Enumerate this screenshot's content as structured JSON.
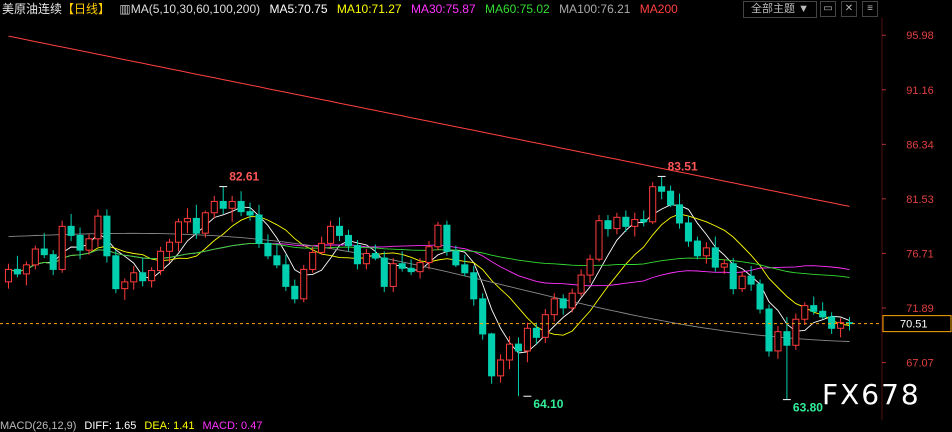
{
  "header": {
    "title": "美原油连续",
    "period": "【日线】",
    "ma_params": "MA(5,10,30,60,100,200)",
    "ma5": "MA5:70.75",
    "ma10": "MA10:71.27",
    "ma30": "MA30:75.87",
    "ma60": "MA60:75.02",
    "ma100": "MA100:76.21",
    "ma200": "MA200",
    "theme_button": "全部主题 ▼",
    "colors": {
      "ma5": "#ffffff",
      "ma10": "#ffff00",
      "ma30": "#ff33ff",
      "ma60": "#33dd33",
      "ma100": "#aaaaaa",
      "ma200": "#ff4040"
    }
  },
  "macd_line": {
    "label": "MACD(26,12,9)",
    "diff": "DIFF: 1.65",
    "dea": "DEA: 1.41",
    "macd": "MACD: 0.47"
  },
  "watermark": "FX678",
  "chart_data": {
    "type": "candlestick",
    "ylim": [
      62.0,
      97.5
    ],
    "yticks": [
      "95.98",
      "91.16",
      "86.34",
      "81.53",
      "76.71",
      "71.89",
      "67.07"
    ],
    "current_price": "70.51",
    "annotations": [
      {
        "label": "82.61",
        "index": 24,
        "value": 82.61,
        "kind": "high"
      },
      {
        "label": "83.51",
        "index": 73,
        "value": 83.51,
        "kind": "high"
      },
      {
        "label": "64.10",
        "index": 58,
        "value": 64.1,
        "kind": "low"
      },
      {
        "label": "63.80",
        "index": 87,
        "value": 63.8,
        "kind": "low"
      }
    ],
    "candles": [
      [
        74.2,
        75.8,
        73.6,
        75.3
      ],
      [
        75.3,
        76.5,
        74.6,
        74.9
      ],
      [
        74.9,
        76.0,
        73.9,
        75.7
      ],
      [
        75.7,
        77.4,
        75.3,
        77.1
      ],
      [
        77.1,
        78.5,
        76.3,
        76.6
      ],
      [
        76.6,
        77.0,
        74.8,
        75.3
      ],
      [
        75.3,
        79.6,
        75.0,
        79.1
      ],
      [
        79.1,
        80.2,
        77.8,
        78.3
      ],
      [
        78.3,
        79.0,
        76.2,
        77.0
      ],
      [
        77.0,
        78.4,
        76.6,
        78.0
      ],
      [
        78.0,
        80.6,
        77.3,
        80.0
      ],
      [
        80.0,
        80.6,
        75.9,
        76.5
      ],
      [
        76.5,
        77.0,
        73.2,
        73.6
      ],
      [
        73.6,
        74.5,
        72.6,
        74.2
      ],
      [
        74.2,
        75.6,
        73.5,
        75.0
      ],
      [
        75.0,
        76.3,
        73.8,
        74.3
      ],
      [
        74.3,
        75.5,
        73.7,
        75.2
      ],
      [
        75.2,
        77.3,
        74.8,
        76.9
      ],
      [
        76.9,
        78.0,
        75.9,
        77.7
      ],
      [
        77.7,
        79.8,
        76.9,
        79.5
      ],
      [
        79.5,
        80.7,
        78.5,
        79.8
      ],
      [
        79.8,
        81.0,
        78.0,
        78.5
      ],
      [
        78.5,
        80.5,
        78.1,
        80.3
      ],
      [
        80.3,
        81.8,
        79.8,
        81.3
      ],
      [
        81.3,
        82.61,
        80.2,
        80.7
      ],
      [
        80.7,
        81.8,
        79.5,
        81.3
      ],
      [
        81.3,
        82.2,
        80.0,
        80.4
      ],
      [
        80.4,
        81.2,
        79.6,
        80.1
      ],
      [
        80.1,
        81.0,
        77.2,
        77.6
      ],
      [
        77.6,
        78.4,
        76.2,
        76.5
      ],
      [
        76.5,
        77.6,
        75.4,
        75.7
      ],
      [
        75.7,
        76.6,
        73.4,
        73.8
      ],
      [
        73.8,
        74.4,
        72.3,
        72.7
      ],
      [
        72.7,
        75.7,
        72.4,
        75.3
      ],
      [
        75.3,
        77.3,
        75.0,
        76.8
      ],
      [
        76.8,
        78.2,
        76.6,
        77.6
      ],
      [
        77.6,
        79.6,
        77.1,
        79.1
      ],
      [
        79.1,
        79.9,
        77.8,
        78.3
      ],
      [
        78.3,
        78.8,
        76.9,
        77.4
      ],
      [
        77.4,
        77.9,
        75.3,
        75.8
      ],
      [
        75.8,
        77.1,
        75.3,
        76.7
      ],
      [
        76.7,
        77.5,
        76.1,
        76.3
      ],
      [
        76.3,
        76.9,
        73.3,
        73.8
      ],
      [
        73.8,
        76.3,
        73.3,
        75.8
      ],
      [
        75.8,
        76.9,
        75.1,
        75.4
      ],
      [
        75.4,
        76.2,
        74.8,
        75.1
      ],
      [
        75.1,
        76.3,
        74.5,
        75.9
      ],
      [
        75.9,
        77.8,
        75.3,
        77.3
      ],
      [
        77.3,
        79.5,
        77.0,
        79.2
      ],
      [
        79.2,
        79.6,
        76.5,
        76.9
      ],
      [
        76.9,
        77.4,
        75.5,
        75.7
      ],
      [
        75.7,
        76.6,
        74.7,
        75.0
      ],
      [
        75.0,
        75.6,
        72.1,
        72.7
      ],
      [
        72.7,
        73.2,
        69.1,
        69.6
      ],
      [
        69.6,
        69.7,
        65.2,
        65.9
      ],
      [
        65.9,
        67.8,
        65.3,
        67.3
      ],
      [
        67.3,
        69.4,
        66.5,
        68.7
      ],
      [
        68.7,
        69.3,
        64.1,
        68.1
      ],
      [
        68.1,
        70.6,
        67.1,
        70.1
      ],
      [
        70.1,
        70.6,
        68.7,
        69.3
      ],
      [
        69.3,
        71.8,
        68.8,
        71.3
      ],
      [
        71.3,
        73.2,
        70.7,
        72.7
      ],
      [
        72.7,
        73.1,
        71.3,
        71.9
      ],
      [
        71.9,
        73.6,
        71.5,
        73.2
      ],
      [
        73.2,
        75.3,
        72.9,
        74.8
      ],
      [
        74.8,
        76.6,
        74.1,
        76.2
      ],
      [
        76.2,
        80.1,
        76.0,
        79.6
      ],
      [
        79.6,
        80.1,
        78.2,
        78.9
      ],
      [
        78.9,
        80.3,
        78.4,
        79.9
      ],
      [
        79.9,
        80.5,
        78.6,
        79.1
      ],
      [
        79.1,
        80.3,
        78.2,
        79.7
      ],
      [
        79.7,
        80.5,
        79.1,
        79.5
      ],
      [
        79.5,
        83.0,
        79.3,
        82.6
      ],
      [
        82.6,
        83.51,
        81.5,
        82.2
      ],
      [
        82.2,
        82.7,
        80.8,
        81.0
      ],
      [
        81.0,
        82.0,
        78.9,
        79.4
      ],
      [
        79.4,
        80.0,
        77.3,
        77.8
      ],
      [
        77.8,
        78.2,
        76.2,
        76.5
      ],
      [
        76.5,
        77.7,
        75.8,
        77.2
      ],
      [
        77.2,
        78.2,
        75.1,
        75.5
      ],
      [
        75.5,
        76.2,
        74.9,
        75.8
      ],
      [
        75.8,
        76.3,
        73.1,
        73.6
      ],
      [
        73.6,
        75.1,
        73.3,
        74.7
      ],
      [
        74.7,
        75.6,
        73.4,
        74.0
      ],
      [
        74.0,
        74.4,
        71.4,
        71.8
      ],
      [
        71.8,
        72.2,
        67.6,
        68.1
      ],
      [
        68.1,
        70.3,
        67.4,
        69.8
      ],
      [
        69.8,
        71.1,
        63.8,
        68.6
      ],
      [
        68.6,
        71.4,
        68.2,
        70.9
      ],
      [
        70.9,
        72.4,
        70.4,
        72.1
      ],
      [
        72.1,
        72.9,
        71.3,
        71.6
      ],
      [
        71.6,
        72.4,
        70.9,
        71.1
      ],
      [
        71.1,
        71.5,
        69.6,
        70.1
      ],
      [
        70.1,
        71.0,
        69.3,
        70.6
      ],
      [
        70.6,
        71.1,
        69.9,
        70.51
      ]
    ]
  }
}
